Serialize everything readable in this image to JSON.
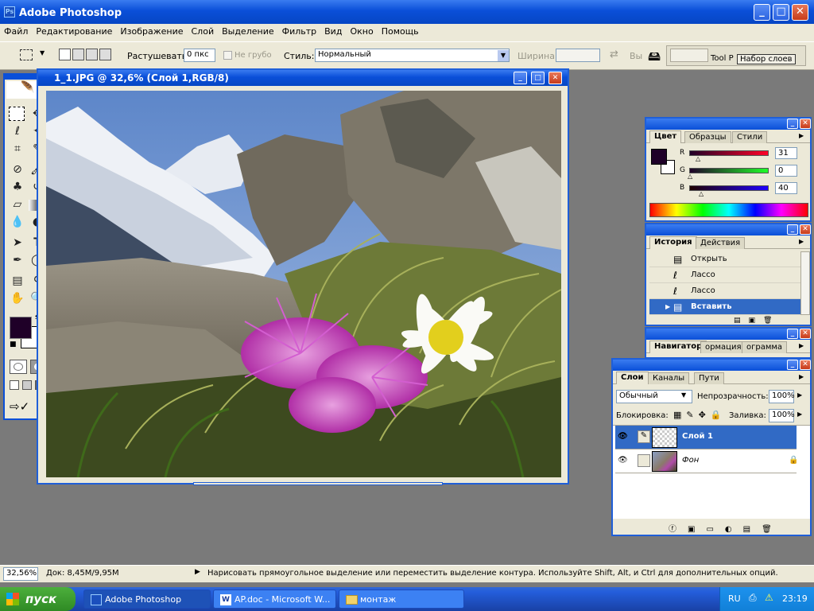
{
  "app": {
    "title": "Adobe Photoshop"
  },
  "menu": [
    "Файл",
    "Редактирование",
    "Изображение",
    "Слой",
    "Выделение",
    "Фильтр",
    "Вид",
    "Окно",
    "Помощь"
  ],
  "options": {
    "feather_label": "Растушевать:",
    "feather_value": "0 пкс",
    "antialias_label": "Не грубо",
    "style_label": "Стиль:",
    "style_value": "Нормальный",
    "width_label": "Ширина:",
    "height_label": "Вы",
    "tool_presets": "Tool P",
    "layer_sets": "Набор слоев"
  },
  "document": {
    "title": "1_1.JPG @ 32,6% (Слой 1,RGB/8)"
  },
  "color_panel": {
    "tabs": [
      "Цвет",
      "Образцы",
      "Стили"
    ],
    "r_label": "R",
    "g_label": "G",
    "b_label": "B",
    "r": "31",
    "g": "0",
    "b": "40",
    "fg_color": "#1f0028"
  },
  "history_panel": {
    "tabs": [
      "История",
      "Действия"
    ],
    "items": [
      "Открыть",
      "Лассо",
      "Лассо",
      "Вставить"
    ]
  },
  "navigator_panel": {
    "tabs": [
      "Навигатор",
      "ормация",
      "ограмма"
    ]
  },
  "layers_panel": {
    "tabs": [
      "Слои",
      "Каналы",
      "Пути"
    ],
    "blend_mode": "Обычный",
    "opacity_label": "Непрозрачность:",
    "opacity_value": "100%",
    "lock_label": "Блокировка:",
    "fill_label": "Заливка:",
    "fill_value": "100%",
    "layers": [
      {
        "name": "Слой 1"
      },
      {
        "name": "Фон"
      }
    ]
  },
  "status": {
    "zoom": "32,56%",
    "doc": "Док: 8,45M/9,95M",
    "hint": "Нарисовать прямоугольное выделение или переместить выделение контура. Используйте Shift, Alt, и Ctrl для дополнительных опций."
  },
  "taskbar": {
    "start": "пуск",
    "tasks": [
      "Adobe Photoshop",
      "AP.doc - Microsoft W...",
      "монтаж"
    ],
    "lang": "RU",
    "clock": "23:19"
  }
}
